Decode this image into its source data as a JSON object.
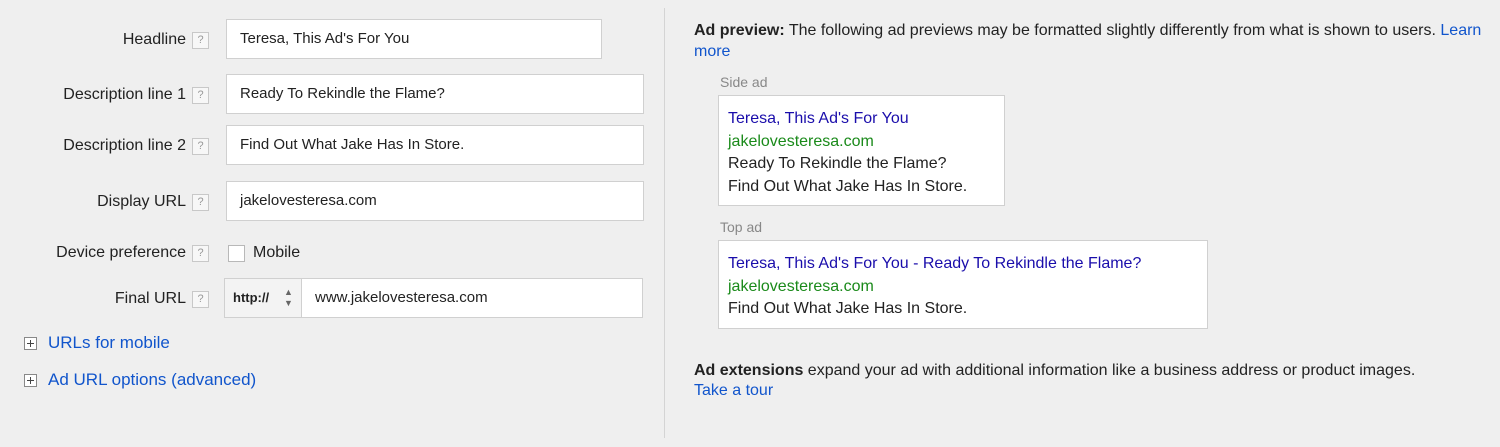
{
  "form": {
    "headline": {
      "label": "Headline",
      "value": "Teresa, This Ad's For You"
    },
    "description1": {
      "label": "Description line 1",
      "value": "Ready To Rekindle the Flame?"
    },
    "description2": {
      "label": "Description line 2",
      "value": "Find Out What Jake Has In Store."
    },
    "display_url": {
      "label": "Display URL",
      "value": "jakelovesteresa.com"
    },
    "device": {
      "label": "Device preference",
      "checkbox_label": "Mobile",
      "checked": false
    },
    "final_url": {
      "label": "Final URL",
      "protocol": "http://",
      "value": "www.jakelovesteresa.com"
    },
    "help_glyph": "?",
    "protocol_arrows": "▲▼"
  },
  "expanders": {
    "urls_mobile": "URLs for mobile",
    "ad_url_options": "Ad URL options (advanced)"
  },
  "preview": {
    "heading_bold": "Ad preview:",
    "heading_text": " The following ad previews may be formatted slightly differently from what is shown to users. ",
    "learn_more": "Learn more",
    "side_ad": {
      "label": "Side ad",
      "title": "Teresa, This Ad's For You",
      "url": "jakelovesteresa.com",
      "line1": "Ready To Rekindle the Flame?",
      "line2": "Find Out What Jake Has In Store."
    },
    "top_ad": {
      "label": "Top ad",
      "title": "Teresa, This Ad's For You - Ready To Rekindle the Flame?",
      "url": "jakelovesteresa.com",
      "line1": "Find Out What Jake Has In Store."
    }
  },
  "extensions": {
    "bold": "Ad extensions",
    "text": " expand your ad with additional information like a business address or product images.",
    "tour_link": "Take a tour"
  },
  "colors": {
    "link": "#1155cc",
    "ad_title": "#1a0dab",
    "ad_url": "#1a8a1a",
    "background": "#efefef"
  }
}
